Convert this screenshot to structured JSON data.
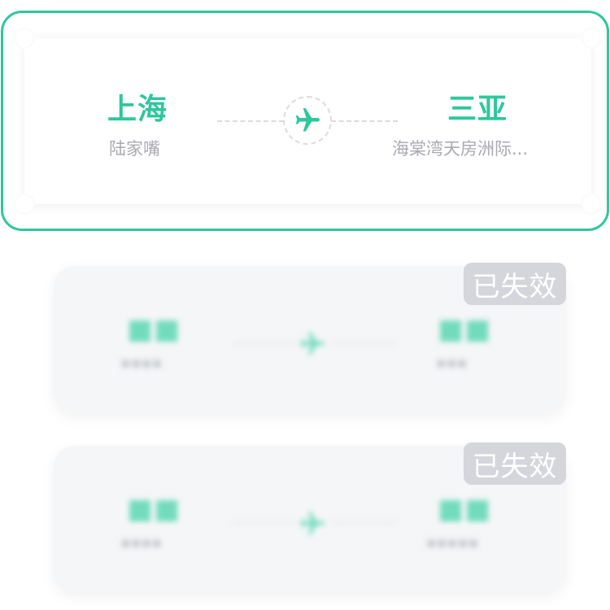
{
  "active_route": {
    "from_city": "上海",
    "from_place": "陆家嘴",
    "to_city": "三亚",
    "to_place": "海棠湾天房洲际..."
  },
  "expired_routes": [
    {
      "badge": "已失效"
    },
    {
      "badge": "已失效"
    }
  ],
  "colors": {
    "accent": "#2ec79e",
    "border_selected": "#2ec79e",
    "badge_bg": "#d4d6dc",
    "muted_text": "#a9a9b1"
  },
  "icons": {
    "transport": "airplane-icon"
  }
}
